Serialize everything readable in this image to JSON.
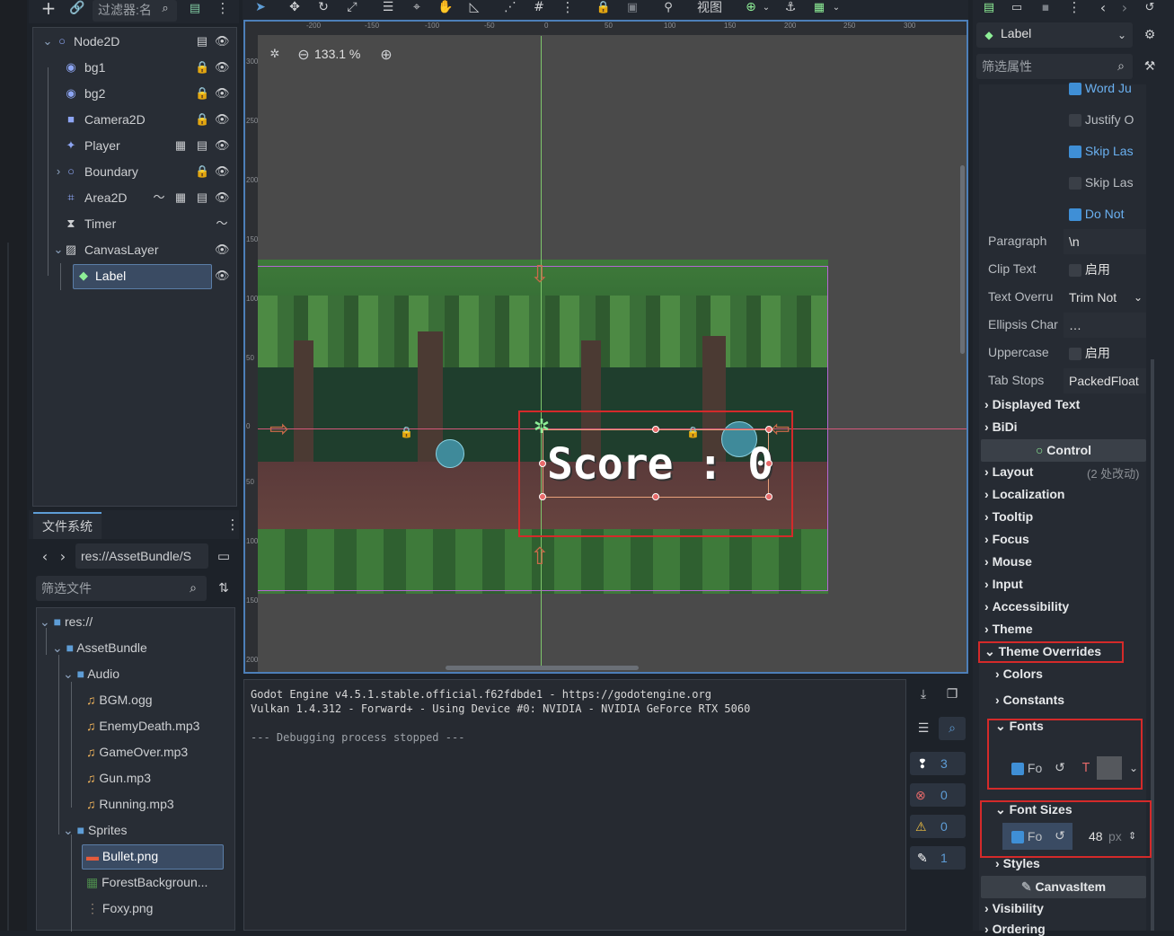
{
  "scene_dock": {
    "filter_placeholder": "过滤器:名",
    "nodes": [
      {
        "label": "Node2D",
        "icon": "node2d-icon"
      },
      {
        "label": "bg1",
        "icon": "sprite-icon"
      },
      {
        "label": "bg2",
        "icon": "sprite-icon"
      },
      {
        "label": "Camera2D",
        "icon": "camera-icon"
      },
      {
        "label": "Player",
        "icon": "character-icon"
      },
      {
        "label": "Boundary",
        "icon": "node2d-icon"
      },
      {
        "label": "Area2D",
        "icon": "area-icon"
      },
      {
        "label": "Timer",
        "icon": "timer-icon"
      },
      {
        "label": "CanvasLayer",
        "icon": "canvas-layer-icon"
      },
      {
        "label": "Label",
        "icon": "label-icon"
      }
    ]
  },
  "filesystem": {
    "tab": "文件系统",
    "path": "res://AssetBundle/S",
    "filter_placeholder": "筛选文件",
    "items": [
      {
        "label": "res://",
        "icon": "folder-icon"
      },
      {
        "label": "AssetBundle",
        "icon": "folder-icon"
      },
      {
        "label": "Audio",
        "icon": "folder-icon"
      },
      {
        "label": "BGM.ogg",
        "icon": "audio-file-icon"
      },
      {
        "label": "EnemyDeath.mp3",
        "icon": "audio-file-icon"
      },
      {
        "label": "GameOver.mp3",
        "icon": "audio-file-icon"
      },
      {
        "label": "Gun.mp3",
        "icon": "audio-file-icon"
      },
      {
        "label": "Running.mp3",
        "icon": "audio-file-icon"
      },
      {
        "label": "Sprites",
        "icon": "folder-icon"
      },
      {
        "label": "Bullet.png",
        "icon": "image-file-icon"
      },
      {
        "label": "ForestBackgroun...",
        "icon": "image-file-icon"
      },
      {
        "label": "Foxy.png",
        "icon": "image-file-icon"
      }
    ]
  },
  "toolbar": {
    "view_menu": "视图"
  },
  "viewport": {
    "zoom": "133.1 %",
    "score_text": "Score : 0",
    "ruler_top": [
      "-200",
      "-150",
      "-100",
      "-50",
      "0",
      "50",
      "100",
      "150",
      "200",
      "250",
      "300"
    ],
    "ruler_left": [
      "300",
      "250",
      "200",
      "150",
      "100",
      "50",
      "0",
      "50",
      "100",
      "150",
      "200"
    ]
  },
  "output": {
    "lines": [
      "Godot Engine v4.5.1.stable.official.f62fdbde1 - https://godotengine.org",
      "Vulkan 1.4.312 - Forward+ - Using Device #0: NVIDIA - NVIDIA GeForce RTX 5060",
      "",
      "--- Debugging process stopped ---"
    ],
    "counts": {
      "messages": "3",
      "errors": "0",
      "warnings": "0",
      "editor": "1"
    }
  },
  "inspector": {
    "node_type": "Label",
    "filter_placeholder": "筛选属性",
    "checks": [
      {
        "label": "Word Ju",
        "checked": true
      },
      {
        "label": "Justify O",
        "checked": false
      },
      {
        "label": "Skip Las",
        "checked": true
      },
      {
        "label": "Skip Las",
        "checked": false
      },
      {
        "label": "Do Not",
        "checked": true
      }
    ],
    "props": {
      "paragraph": {
        "label": "Paragraph",
        "value": "\\n"
      },
      "clip_text": {
        "label": "Clip Text",
        "value": "启用"
      },
      "text_overrun": {
        "label": "Text Overru",
        "value": "Trim Not"
      },
      "ellipsis": {
        "label": "Ellipsis Char",
        "value": "…"
      },
      "uppercase": {
        "label": "Uppercase",
        "value": "启用"
      },
      "tab_stops": {
        "label": "Tab Stops",
        "value": "PackedFloat"
      }
    },
    "sections": {
      "displayed_text": "Displayed Text",
      "bidi": "BiDi",
      "control": "Control",
      "layout": "Layout",
      "layout_note": "(2 处改动)",
      "localization": "Localization",
      "tooltip": "Tooltip",
      "focus": "Focus",
      "mouse": "Mouse",
      "input": "Input",
      "accessibility": "Accessibility",
      "theme": "Theme",
      "theme_overrides": "Theme Overrides",
      "colors": "Colors",
      "constants": "Constants",
      "fonts": "Fonts",
      "font_sizes": "Font Sizes",
      "styles": "Styles",
      "canvas_item": "CanvasItem",
      "visibility": "Visibility",
      "ordering": "Ordering"
    },
    "font_row_label": "Fo",
    "font_size_label": "Fo",
    "font_size_value": "48",
    "font_size_unit": "px"
  }
}
